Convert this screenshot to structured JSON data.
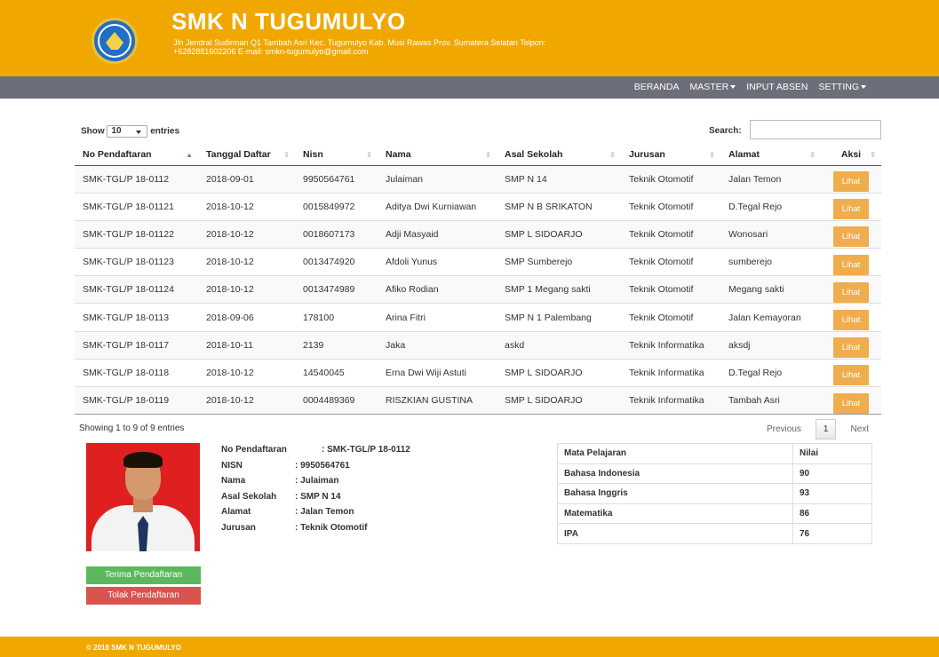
{
  "header": {
    "title": "SMK N TUGUMULYO",
    "address": "Jln Jendral Sudirman Q1 Tambah Asri Kec. Tugumulyo Kab. Musi Rawas Prov. Sumatera Selatan Telpon: +6282881602206 E-mail: smkn-tugumulyo@gmail.com"
  },
  "nav": {
    "beranda": "BERANDA",
    "master": "MASTER",
    "input_absen": "INPUT ABSEN",
    "setting": "SETTING"
  },
  "table_controls": {
    "show": "Show",
    "length": "10",
    "entries": "entries",
    "search_label": "Search:",
    "search_value": ""
  },
  "columns": [
    "No Pendaftaran",
    "Tanggal Daftar",
    "Nisn",
    "Nama",
    "Asal Sekolah",
    "Jurusan",
    "Alamat",
    "Aksi"
  ],
  "rows": [
    {
      "no": "SMK-TGL/P 18-0112",
      "tanggal": "2018-09-01",
      "nisn": "9950564761",
      "nama": "Julaiman",
      "asal": "SMP N 14",
      "jurusan": "Teknik Otomotif",
      "alamat": "Jalan Temon",
      "aksi": "Lihat"
    },
    {
      "no": "SMK-TGL/P 18-01121",
      "tanggal": "2018-10-12",
      "nisn": "0015849972",
      "nama": "Aditya Dwi Kurniawan",
      "asal": "SMP N B SRIKATON",
      "jurusan": "Teknik Otomotif",
      "alamat": "D.Tegal Rejo",
      "aksi": "Lihat"
    },
    {
      "no": "SMK-TGL/P 18-01122",
      "tanggal": "2018-10-12",
      "nisn": "0018607173",
      "nama": "Adji Masyaid",
      "asal": "SMP L SIDOARJO",
      "jurusan": "Teknik Otomotif",
      "alamat": "Wonosari",
      "aksi": "Lihat"
    },
    {
      "no": "SMK-TGL/P 18-01123",
      "tanggal": "2018-10-12",
      "nisn": "0013474920",
      "nama": "Afdoli Yunus",
      "asal": "SMP Sumberejo",
      "jurusan": "Teknik Otomotif",
      "alamat": "sumberejo",
      "aksi": "Lihat"
    },
    {
      "no": "SMK-TGL/P 18-01124",
      "tanggal": "2018-10-12",
      "nisn": "0013474989",
      "nama": "Afiko Rodian",
      "asal": "SMP 1 Megang sakti",
      "jurusan": "Teknik Otomotif",
      "alamat": "Megang sakti",
      "aksi": "Lihat"
    },
    {
      "no": "SMK-TGL/P 18-0113",
      "tanggal": "2018-09-06",
      "nisn": "178100",
      "nama": "Arina Fitri",
      "asal": "SMP N 1 Palembang",
      "jurusan": "Teknik Otomotif",
      "alamat": "Jalan Kemayoran",
      "aksi": "Lihat"
    },
    {
      "no": "SMK-TGL/P 18-0117",
      "tanggal": "2018-10-11",
      "nisn": "2139",
      "nama": "Jaka",
      "asal": "askd",
      "jurusan": "Teknik Informatika",
      "alamat": "aksdj",
      "aksi": "Lihat"
    },
    {
      "no": "SMK-TGL/P 18-0118",
      "tanggal": "2018-10-12",
      "nisn": "14540045",
      "nama": "Erna Dwi Wiji Astuti",
      "asal": "SMP L SIDOARJO",
      "jurusan": "Teknik Informatika",
      "alamat": "D.Tegal Rejo",
      "aksi": "Lihat"
    },
    {
      "no": "SMK-TGL/P 18-0119",
      "tanggal": "2018-10-12",
      "nisn": "0004489369",
      "nama": "RISZKIAN GUSTINA",
      "asal": "SMP L SIDOARJO",
      "jurusan": "Teknik Informatika",
      "alamat": "Tambah Asri",
      "aksi": "Lihat"
    }
  ],
  "info": "Showing 1 to 9 of 9 entries",
  "pagination": {
    "previous": "Previous",
    "current": "1",
    "next": "Next"
  },
  "detail": [
    {
      "label": "No Pendaftaran",
      "value": ": SMK-TGL/P 18-0112"
    },
    {
      "label": "NISN",
      "value": ": 9950564761"
    },
    {
      "label": "Nama",
      "value": ": Julaiman"
    },
    {
      "label": "Asal Sekolah",
      "value": ": SMP N 14"
    },
    {
      "label": "Alamat",
      "value": ": Jalan Temon"
    },
    {
      "label": "Jurusan",
      "value": ": Teknik Otomotif"
    }
  ],
  "grades": {
    "header": {
      "subject": "Mata Pelajaran",
      "score": "Nilai"
    },
    "items": [
      {
        "subject": "Bahasa Indonesia",
        "score": "90"
      },
      {
        "subject": "Bahasa Inggris",
        "score": "93"
      },
      {
        "subject": "Matematika",
        "score": "86"
      },
      {
        "subject": "IPA",
        "score": "76"
      }
    ]
  },
  "actions": {
    "accept": "Terima Pendaftaran",
    "reject": "Tolak Pendaftaran"
  },
  "footer": "© 2018 SMK N TUGUMULYO",
  "colors": {
    "brand": "#f0a800",
    "navbar": "#6c6f79",
    "lihat": "#f0ad4e",
    "accept": "#5cb85c",
    "reject": "#d9534f"
  }
}
